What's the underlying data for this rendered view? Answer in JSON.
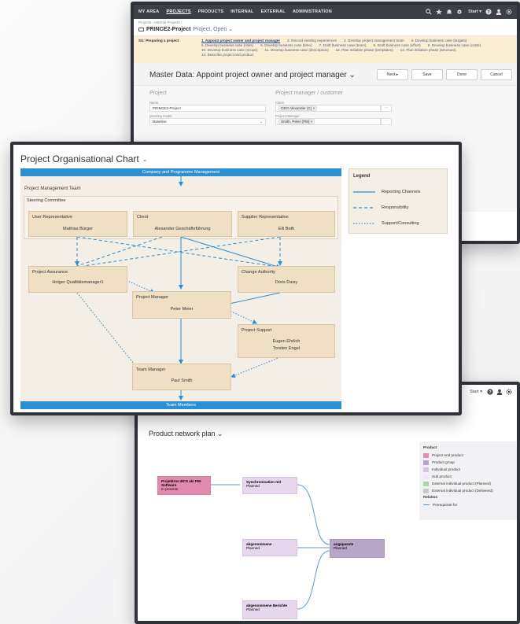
{
  "colors": {
    "band_blue": "#2d8fd3",
    "box_fill": "#efdfc4",
    "area_bg": "#f4efe6",
    "su_band": "#fbeed3"
  },
  "master_window": {
    "nav": [
      "MY AREA",
      "PROJECTS",
      "PRODUCTS",
      "INTERNAL",
      "EXTERNAL",
      "ADMINISTRATION"
    ],
    "start_label": "Start ▾",
    "breadcrumb": "Projects › Internal Projects ›",
    "project_title": "PRINCE2-Project",
    "project_status": "Project, Open ⌄",
    "su_label": "SU: Preparing a project:",
    "steps": [
      "1. Appoint project owner and project manager",
      "2. Record existing experiences",
      "3. Develop project management team",
      "4. Develop business case (targets)",
      "5. Develop business case (risks)",
      "6. Develop business case (time)",
      "7. Draft business case (team)",
      "8. Draft business case (effort)",
      "9. Develop business case (costs)",
      "10. Develop business case (scope)",
      "11. Develop business case (description)",
      "12. Plan initiation phase (templates)",
      "13. Plan initiation phase (structure)",
      "14. Describe project end product"
    ],
    "master_title": "Master Data: Appoint project owner and project manager ⌄",
    "buttons": {
      "next": "Next ▸",
      "save": "Save",
      "done": "Done",
      "cancel": "Cancel"
    },
    "project_col": {
      "heading": "Project",
      "name_label": "Name",
      "name_value": "PRINCE2-Project",
      "model_label": "planning model",
      "model_value": "Baseline"
    },
    "pm_col": {
      "heading": "Project manager / customer",
      "client_label": "Client",
      "client_value": "CEO Alexander (C) ×",
      "pm_label": "Project Manager",
      "pm_value": "Smith, Peter (PM) ×",
      "more": "···"
    }
  },
  "network_window": {
    "start_label": "Start ▾",
    "title": "Product network plan ⌄",
    "legend": {
      "product_heading": "Product",
      "items": [
        {
          "label": "Project end product",
          "color": "#e38aaf"
        },
        {
          "label": "Product group",
          "color": "#b4a4c8"
        },
        {
          "label": "Individual product",
          "color": "#d6c3e6"
        },
        {
          "label": "Sub product",
          "color": "#f1e8f7"
        },
        {
          "label": "External individual product (Planned)",
          "color": "#a8d8a8"
        },
        {
          "label": "External individual product (Delivered)",
          "color": "#c8c8c8"
        }
      ],
      "relation_heading": "Relation",
      "relation_item": "Prerequisite for"
    },
    "nodes": {
      "end_product": {
        "title": "Projektron BCS als PM-Software",
        "status": "In process"
      },
      "sync": {
        "title": "Synchronisation mit",
        "status": "Planned"
      },
      "abgenommene": {
        "title": "abgenommene",
        "status": "Planned"
      },
      "berichte": {
        "title": "abgenommene Berichte",
        "status": "Planned"
      },
      "angepasste": {
        "title": "angepasste",
        "status": "Planned"
      }
    }
  },
  "org_window": {
    "title": "Project Organisational Chart",
    "top_band": "Company and Programme Management",
    "bottom_band": "Team Members",
    "pmt_label": "Project Management Team",
    "steering_label": "Steering Committee",
    "boxes": {
      "user_rep": {
        "role": "User Representative",
        "person": "Mathias Bürger"
      },
      "client": {
        "role": "Client",
        "person": "Alexander Geschäftsführung"
      },
      "supplier_rep": {
        "role": "Supplier Representative",
        "person": "Elli Both"
      },
      "assurance": {
        "role": "Project Assurance",
        "person": "Holger Qualitätsmanager1"
      },
      "change_auth": {
        "role": "Change Authority",
        "person": "Doris Daisy"
      },
      "pm": {
        "role": "Project Manager",
        "person": "Peter Meier"
      },
      "support": {
        "role": "Project Support",
        "person": "Eugen Ehrlich",
        "person2": "Torsten Engel"
      },
      "team_mgr": {
        "role": "Team Manager",
        "person": "Paul Smith"
      }
    },
    "legend": {
      "heading": "Legend",
      "reporting": "Reporting Channels",
      "responsibility": "Responsibility",
      "support": "Support/Consulting"
    }
  }
}
